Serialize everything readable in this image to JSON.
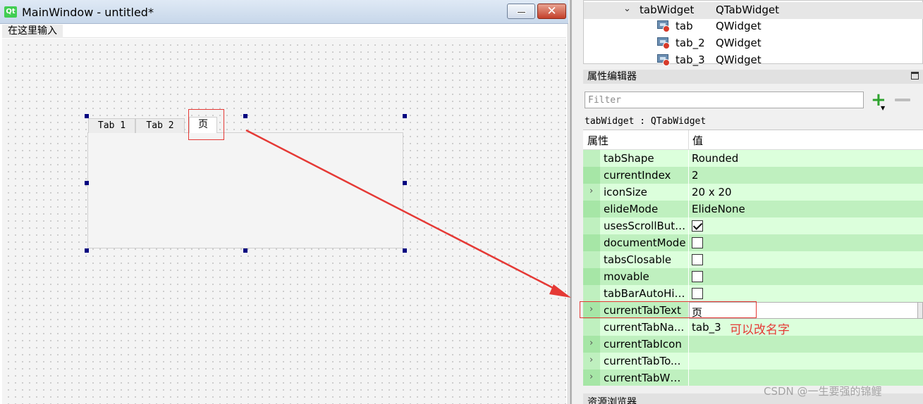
{
  "window": {
    "title": "MainWindow - untitled*",
    "logo": "Qt",
    "minimize_glyph": "—",
    "close_glyph": "✕"
  },
  "menubar": {
    "placeholder_item": "在这里输入"
  },
  "form_tabs": [
    {
      "label": "Tab 1"
    },
    {
      "label": "Tab 2"
    },
    {
      "label": "页"
    }
  ],
  "object_tree": [
    {
      "name": "tabWidget",
      "class": "QTabWidget",
      "expanded": true,
      "selected": true
    },
    {
      "name": "tab",
      "class": "QWidget"
    },
    {
      "name": "tab_2",
      "class": "QWidget"
    },
    {
      "name": "tab_3",
      "class": "QWidget"
    }
  ],
  "property_editor": {
    "title": "属性编辑器",
    "filter_placeholder": "Filter",
    "object_class": "tabWidget : QTabWidget",
    "header": {
      "property": "属性",
      "value": "值"
    },
    "rows": [
      {
        "name": "tabShape",
        "value": "Rounded"
      },
      {
        "name": "currentIndex",
        "value": "2"
      },
      {
        "name": "iconSize",
        "value": "20 x 20",
        "expandable": true
      },
      {
        "name": "elideMode",
        "value": "ElideNone"
      },
      {
        "name": "usesScrollButt...",
        "checked": true
      },
      {
        "name": "documentMode",
        "checked": false
      },
      {
        "name": "tabsClosable",
        "checked": false
      },
      {
        "name": "movable",
        "checked": false
      },
      {
        "name": "tabBarAutoHide",
        "checked": false
      },
      {
        "name": "currentTabText",
        "value": "页",
        "expandable": true,
        "editing": true
      },
      {
        "name": "currentTabNa...",
        "value": "tab_3"
      },
      {
        "name": "currentTabIcon",
        "value": "",
        "expandable": true
      },
      {
        "name": "currentTabTo...",
        "value": "",
        "expandable": true
      },
      {
        "name": "currentTabWh...",
        "value": "",
        "expandable": true
      }
    ]
  },
  "annotation": {
    "text": "可以改名字",
    "color": "#e53935"
  },
  "bottom_dock": {
    "title": "资源浏览器"
  },
  "watermark": "CSDN @一生要强的锦鲤",
  "colors": {
    "row_light": "#dcffdc",
    "row_dark": "#bff0bf",
    "highlight": "#e53935",
    "handle": "#000080"
  }
}
